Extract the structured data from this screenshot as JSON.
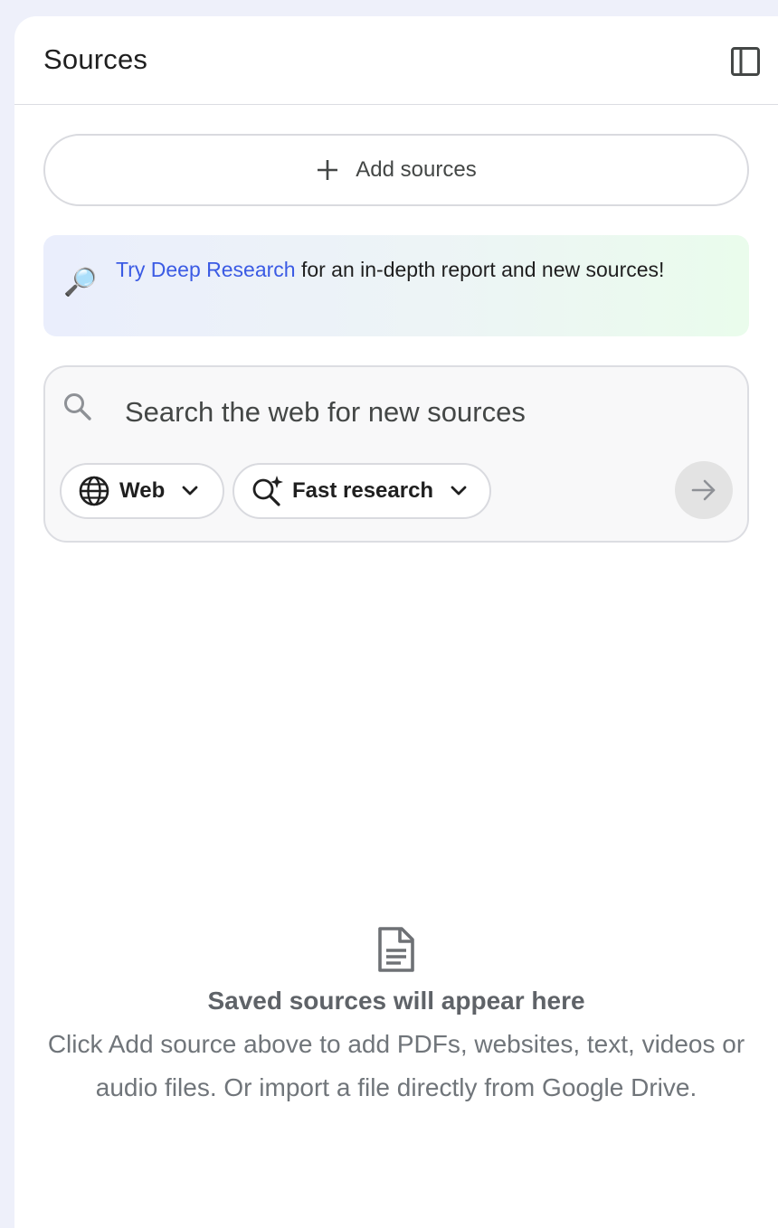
{
  "header": {
    "title": "Sources",
    "collapse_icon": "side-panel-icon"
  },
  "add_sources": {
    "icon": "plus-icon",
    "label": "Add sources"
  },
  "promo": {
    "icon": "magnifying-glass-emoji",
    "emoji": "🔎",
    "link_text": "Try Deep Research",
    "rest_text": " for an in-depth report and new sources!"
  },
  "web_search": {
    "icon": "search-icon",
    "placeholder": "Search the web for new sources",
    "source_chip": {
      "icon": "globe-icon",
      "label": "Web",
      "dropdown_icon": "chevron-down-icon"
    },
    "mode_chip": {
      "icon": "search-sparkle-icon",
      "label": "Fast research",
      "dropdown_icon": "chevron-down-icon"
    },
    "submit_icon": "arrow-right-icon"
  },
  "empty_state": {
    "icon": "document-icon",
    "title": "Saved sources will appear here",
    "description": "Click Add source above to add PDFs, websites, text, videos or audio files. Or import a file directly from Google Drive."
  },
  "colors": {
    "page_background": "#eef0fa",
    "panel_background": "#ffffff",
    "link_blue": "#3b5be4",
    "banner_gradient_start": "#eaeefc",
    "banner_gradient_end": "#eafcec",
    "submit_disabled": "#e3e3e3"
  }
}
